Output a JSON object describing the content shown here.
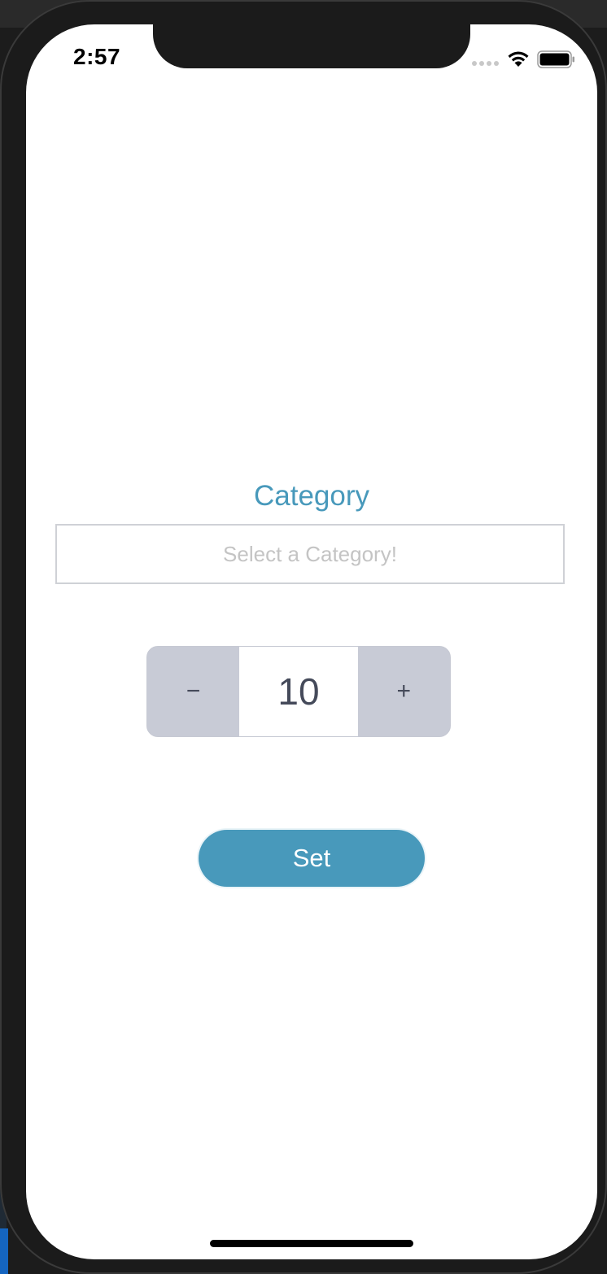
{
  "status_bar": {
    "time": "2:57",
    "wifi_icon": "wifi-icon",
    "battery_icon": "battery-icon"
  },
  "form": {
    "category_label": "Category",
    "category_placeholder": "Select a Category!",
    "stepper": {
      "decrement_label": "−",
      "value": "10",
      "increment_label": "+"
    },
    "set_label": "Set"
  },
  "colors": {
    "accent": "#4899bb",
    "stepper_bg": "#c8cbd6",
    "stepper_text": "#454a5a",
    "placeholder": "#c4c4c4"
  }
}
